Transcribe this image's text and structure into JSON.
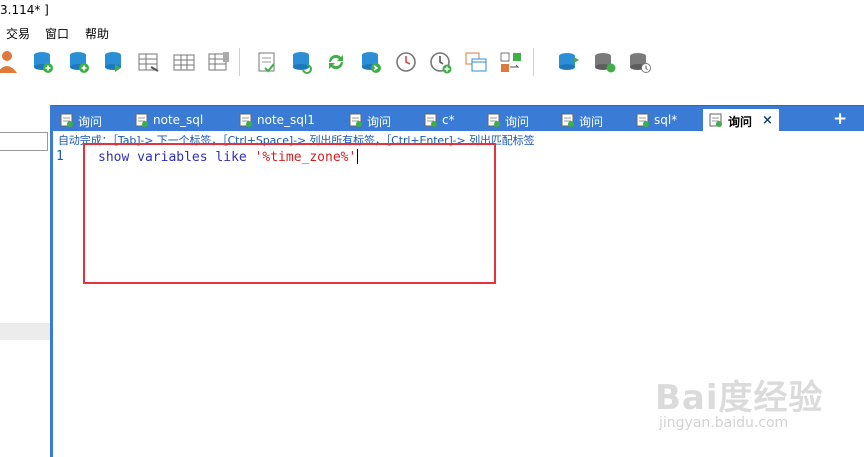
{
  "window": {
    "title": "3.114* ]"
  },
  "menu": {
    "items": [
      "交易",
      "窗口",
      "帮助"
    ]
  },
  "toolbar": {
    "icons": [
      "user-icon",
      "db-add-icon",
      "db-plus-icon",
      "db-export-icon",
      "table-design-icon",
      "table-grid-icon",
      "table-data-icon",
      "query-check-icon",
      "db-refresh-icon",
      "sync-icon",
      "db-forward-icon",
      "schedule-clock-icon",
      "add-schedule-icon",
      "window-layout-icon",
      "compare-icon",
      "db-backup-icon",
      "db-restore-icon",
      "db-manage-icon"
    ]
  },
  "tabs": [
    {
      "label": "询问",
      "active": false
    },
    {
      "label": "note_sql",
      "active": false
    },
    {
      "label": "note_sql1",
      "active": false
    },
    {
      "label": "询问",
      "active": false
    },
    {
      "label": "c*",
      "active": false
    },
    {
      "label": "询问",
      "active": false
    },
    {
      "label": "询问",
      "active": false
    },
    {
      "label": "sql*",
      "active": false
    },
    {
      "label": "询问",
      "active": true
    }
  ],
  "tab_close_glyph": "×",
  "tab_add_glyph": "+",
  "hint": "自动完成：［Tab]-> 下一个标签，［Ctrl+Space]-> 列出所有标签，［Ctrl+Enter]-> 列出匹配标签",
  "editor": {
    "line_number": "1",
    "code": {
      "kw1": "show",
      "kw2": "variables",
      "kw3": "like",
      "string": "'%time_zone%'"
    }
  },
  "watermark": {
    "logo": "Bai度经验",
    "url": "jingyan.baidu.com"
  },
  "colors": {
    "tab_bar": "#3a7bd5",
    "highlight_box": "#e5323b",
    "keyword": "#2f2fb8",
    "string": "#d81e1e"
  }
}
